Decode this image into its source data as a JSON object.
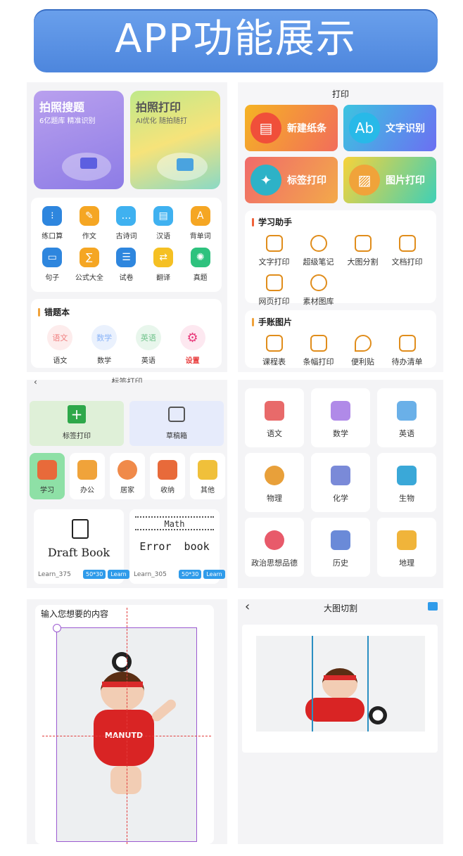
{
  "banner": {
    "title": "APP功能展示"
  },
  "panel1": {
    "card1": {
      "title": "拍照搜题",
      "subtitle": "6亿题库 精准识别",
      "color": "#a78de8"
    },
    "card2": {
      "title": "拍照打印",
      "subtitle": "AI优化 随拍随打",
      "color": "#8ad9c5"
    },
    "grid": [
      {
        "label": "练口算",
        "icon": "calc-icon",
        "color": "#2e86de"
      },
      {
        "label": "作文",
        "icon": "pen-icon",
        "color": "#f5a623"
      },
      {
        "label": "古诗词",
        "icon": "chat-icon",
        "color": "#3fb1f0"
      },
      {
        "label": "汉语",
        "icon": "book-icon",
        "color": "#3fb1f0"
      },
      {
        "label": "背单词",
        "icon": "abc-icon",
        "color": "#f5a623"
      },
      {
        "label": "句子",
        "icon": "monitor-icon",
        "color": "#2e86de"
      },
      {
        "label": "公式大全",
        "icon": "formula-icon",
        "color": "#f5a623"
      },
      {
        "label": "试卷",
        "icon": "paper-icon",
        "color": "#2e86de"
      },
      {
        "label": "翻译",
        "icon": "translate-icon",
        "color": "#f5c023"
      },
      {
        "label": "真题",
        "icon": "atom-icon",
        "color": "#2ec27e"
      }
    ],
    "mistakes": {
      "title": "错题本",
      "items": [
        {
          "label": "语文",
          "icon_text": "语文",
          "color": "#f08080"
        },
        {
          "label": "数学",
          "icon_text": "数学",
          "color": "#8ab4f8"
        },
        {
          "label": "英语",
          "icon_text": "英语",
          "color": "#6fc28a"
        },
        {
          "label": "设置",
          "icon_text": "⚙",
          "color": "#e83a7a"
        }
      ]
    }
  },
  "panel2": {
    "title": "打印",
    "funcs": [
      {
        "label": "新建纸条",
        "color1": "#f5b323",
        "color2": "#f26d5b"
      },
      {
        "label": "文字识别",
        "color1": "#3cc4e0",
        "color2": "#6c6ff2"
      },
      {
        "label": "标签打印",
        "color1": "#f06a6a",
        "color2": "#f3a94a"
      },
      {
        "label": "图片打印",
        "color1": "#f7d23a",
        "color2": "#3fd0b6"
      }
    ],
    "study": {
      "title": "学习助手",
      "items": [
        "文字打印",
        "超级笔记",
        "大图分割",
        "文档打印",
        "网页打印",
        "素材图库"
      ]
    },
    "journal": {
      "title": "手账图片",
      "items": [
        "课程表",
        "条幅打印",
        "便利贴",
        "待办清单"
      ]
    }
  },
  "panel3": {
    "header": "标签打印",
    "top_buttons": [
      "标签打印",
      "草稿箱"
    ],
    "categories": [
      "学习",
      "办公",
      "居家",
      "收纳",
      "其他"
    ],
    "templates": [
      {
        "title": "Draft Book",
        "code": "Learn_375",
        "size": "50*30",
        "tag": "Learn"
      },
      {
        "title": "Error  book",
        "heading": "Math",
        "code": "Learn_305",
        "size": "50*30",
        "tag": "Learn"
      }
    ]
  },
  "panel4": {
    "subjects": [
      "语文",
      "数学",
      "英语",
      "物理",
      "化学",
      "生物",
      "政治思想品德",
      "历史",
      "地理"
    ]
  },
  "panel5": {
    "prompt": "输入您想要的内容",
    "jersey_text": "MANUTD"
  },
  "panel6": {
    "back": "‹",
    "title": "大图切割"
  }
}
